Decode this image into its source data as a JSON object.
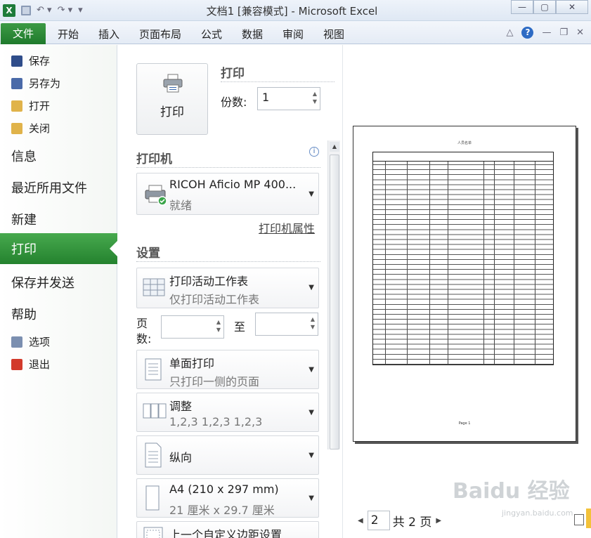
{
  "window": {
    "title": "文档1  [兼容模式] - Microsoft Excel",
    "app_icon": "X",
    "minimize": "—",
    "maximize": "▢",
    "close": "✕"
  },
  "ribbon": {
    "file_tab": "文件",
    "tabs": [
      "开始",
      "插入",
      "页面布局",
      "公式",
      "数据",
      "审阅",
      "视图"
    ]
  },
  "nav": {
    "small_top": [
      {
        "label": "保存",
        "icon": "save-icon",
        "color": "#2f4d8a"
      },
      {
        "label": "另存为",
        "icon": "save-as-icon",
        "color": "#4a6aa8"
      },
      {
        "label": "打开",
        "icon": "folder-open-icon",
        "color": "#e0b34a"
      },
      {
        "label": "关闭",
        "icon": "folder-close-icon",
        "color": "#e0b34a"
      }
    ],
    "large": [
      "信息",
      "最近所用文件",
      "新建",
      "打印",
      "保存并发送",
      "帮助"
    ],
    "active": "打印",
    "small_bottom": [
      {
        "label": "选项",
        "icon": "options-icon",
        "color": "#7b8fb0"
      },
      {
        "label": "退出",
        "icon": "exit-icon",
        "color": "#d23a2b"
      }
    ]
  },
  "print": {
    "button_label": "打印",
    "section_title": "打印",
    "copies_label": "份数:",
    "copies_value": "1",
    "printer_section": "打印机",
    "printer_name": "RICOH Aficio MP 400...",
    "printer_status": "就绪",
    "printer_props_link": "打印机属性",
    "settings_section": "设置",
    "scope_title": "打印活动工作表",
    "scope_sub": "仅打印活动工作表",
    "pages_label": "页数:",
    "pages_to_label": "至",
    "sides_title": "单面打印",
    "sides_sub": "只打印一侧的页面",
    "collate_title": "调整",
    "collate_sub": "1,2,3    1,2,3    1,2,3",
    "orientation": "纵向",
    "paper_title": "A4 (210 x 297 mm)",
    "paper_sub": "21 厘米 x 29.7 厘米",
    "margins_title": "上一个自定义边距设置"
  },
  "preview": {
    "page_title": "人员名单",
    "page_footer": "Page 1",
    "current_page": "2",
    "total_pages": "共 2 页",
    "watermark": "Baidu 经验",
    "watermark_sub": "jingyan.baidu.com"
  },
  "colors": {
    "file_green": "#1f7a2c",
    "active_green": "#24822e",
    "accent_blue": "#2d6bc4"
  }
}
